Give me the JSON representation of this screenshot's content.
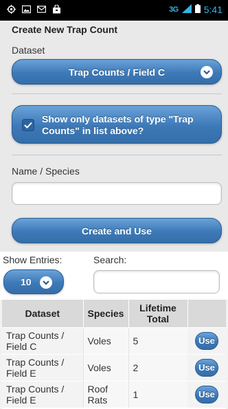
{
  "status_bar": {
    "icons": [
      "gps-icon",
      "image-icon",
      "gmail-icon",
      "bag-icon"
    ],
    "network": "3G",
    "time": "5:41"
  },
  "form": {
    "title": "Create New Trap Count",
    "dataset_label": "Dataset",
    "dataset_value": "Trap Counts / Field C",
    "filter_checkbox_label": "Show only datasets of type \"Trap Counts\" in list above?",
    "filter_checked": true,
    "name_label": "Name / Species",
    "name_value": "",
    "create_button": "Create and Use"
  },
  "table_controls": {
    "show_entries_label": "Show Entries:",
    "entries_value": "10",
    "search_label": "Search:",
    "search_value": ""
  },
  "table": {
    "columns": [
      "Dataset",
      "Species",
      "Lifetime Total",
      ""
    ],
    "rows": [
      {
        "dataset": "Trap Counts / Field C",
        "species": "Voles",
        "total": "5",
        "action": "Use"
      },
      {
        "dataset": "Trap Counts / Field E",
        "species": "Voles",
        "total": "2",
        "action": "Use"
      },
      {
        "dataset": "Trap Counts / Field E",
        "species": "Roof Rats",
        "total": "1",
        "action": "Use"
      }
    ]
  },
  "colors": {
    "accent_blue": "#3d79b8",
    "status_icon_blue": "#33b5e5",
    "panel_bg": "#e9e9e9"
  }
}
